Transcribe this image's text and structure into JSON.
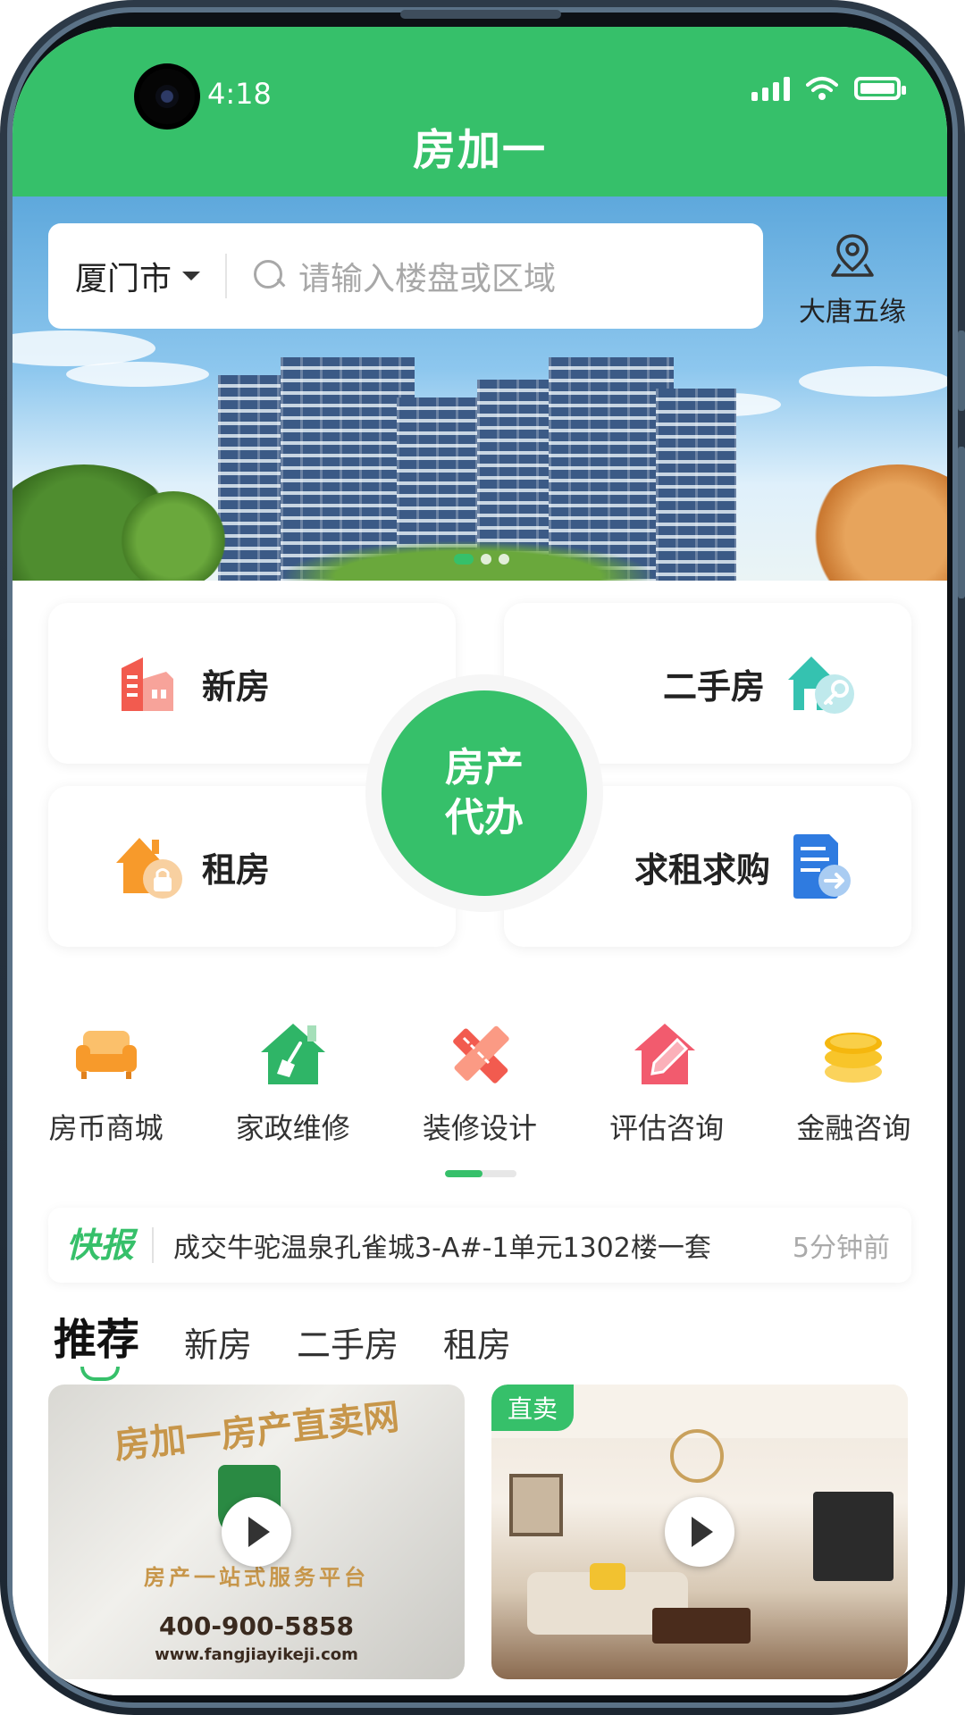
{
  "status_bar": {
    "time": "4:18"
  },
  "header": {
    "title": "房加一"
  },
  "search": {
    "city": "厦门市",
    "placeholder": "请输入楼盘或区域"
  },
  "location": {
    "label": "大唐五缘"
  },
  "banner": {
    "dots_total": 3,
    "active_dot": 1
  },
  "main_cards": {
    "new_house": "新房",
    "second_hand": "二手房",
    "rental": "租房",
    "wanted": "求租求购",
    "center_line1": "房产",
    "center_line2": "代办"
  },
  "services": [
    {
      "label": "房币商城",
      "icon": "sofa-icon"
    },
    {
      "label": "家政维修",
      "icon": "house-broom-icon"
    },
    {
      "label": "装修设计",
      "icon": "ruler-pencil-icon"
    },
    {
      "label": "评估咨询",
      "icon": "house-edit-icon"
    },
    {
      "label": "金融咨询",
      "icon": "coins-icon"
    }
  ],
  "news": {
    "tag": "快报",
    "text": "成交牛驼温泉孔雀城3-A#-1单元1302楼一套",
    "time": "5分钟前"
  },
  "tabs": [
    {
      "label": "推荐",
      "active": true
    },
    {
      "label": "新房",
      "active": false
    },
    {
      "label": "二手房",
      "active": false
    },
    {
      "label": "租房",
      "active": false
    }
  ],
  "listings": [
    {
      "line1": "房加一房产直卖网",
      "line2": "房产一站式服务平台",
      "phone": "400-900-5858",
      "url": "www.fangjiayikeji.com"
    },
    {
      "badge": "直卖"
    }
  ],
  "colors": {
    "accent": "#36c06a"
  }
}
